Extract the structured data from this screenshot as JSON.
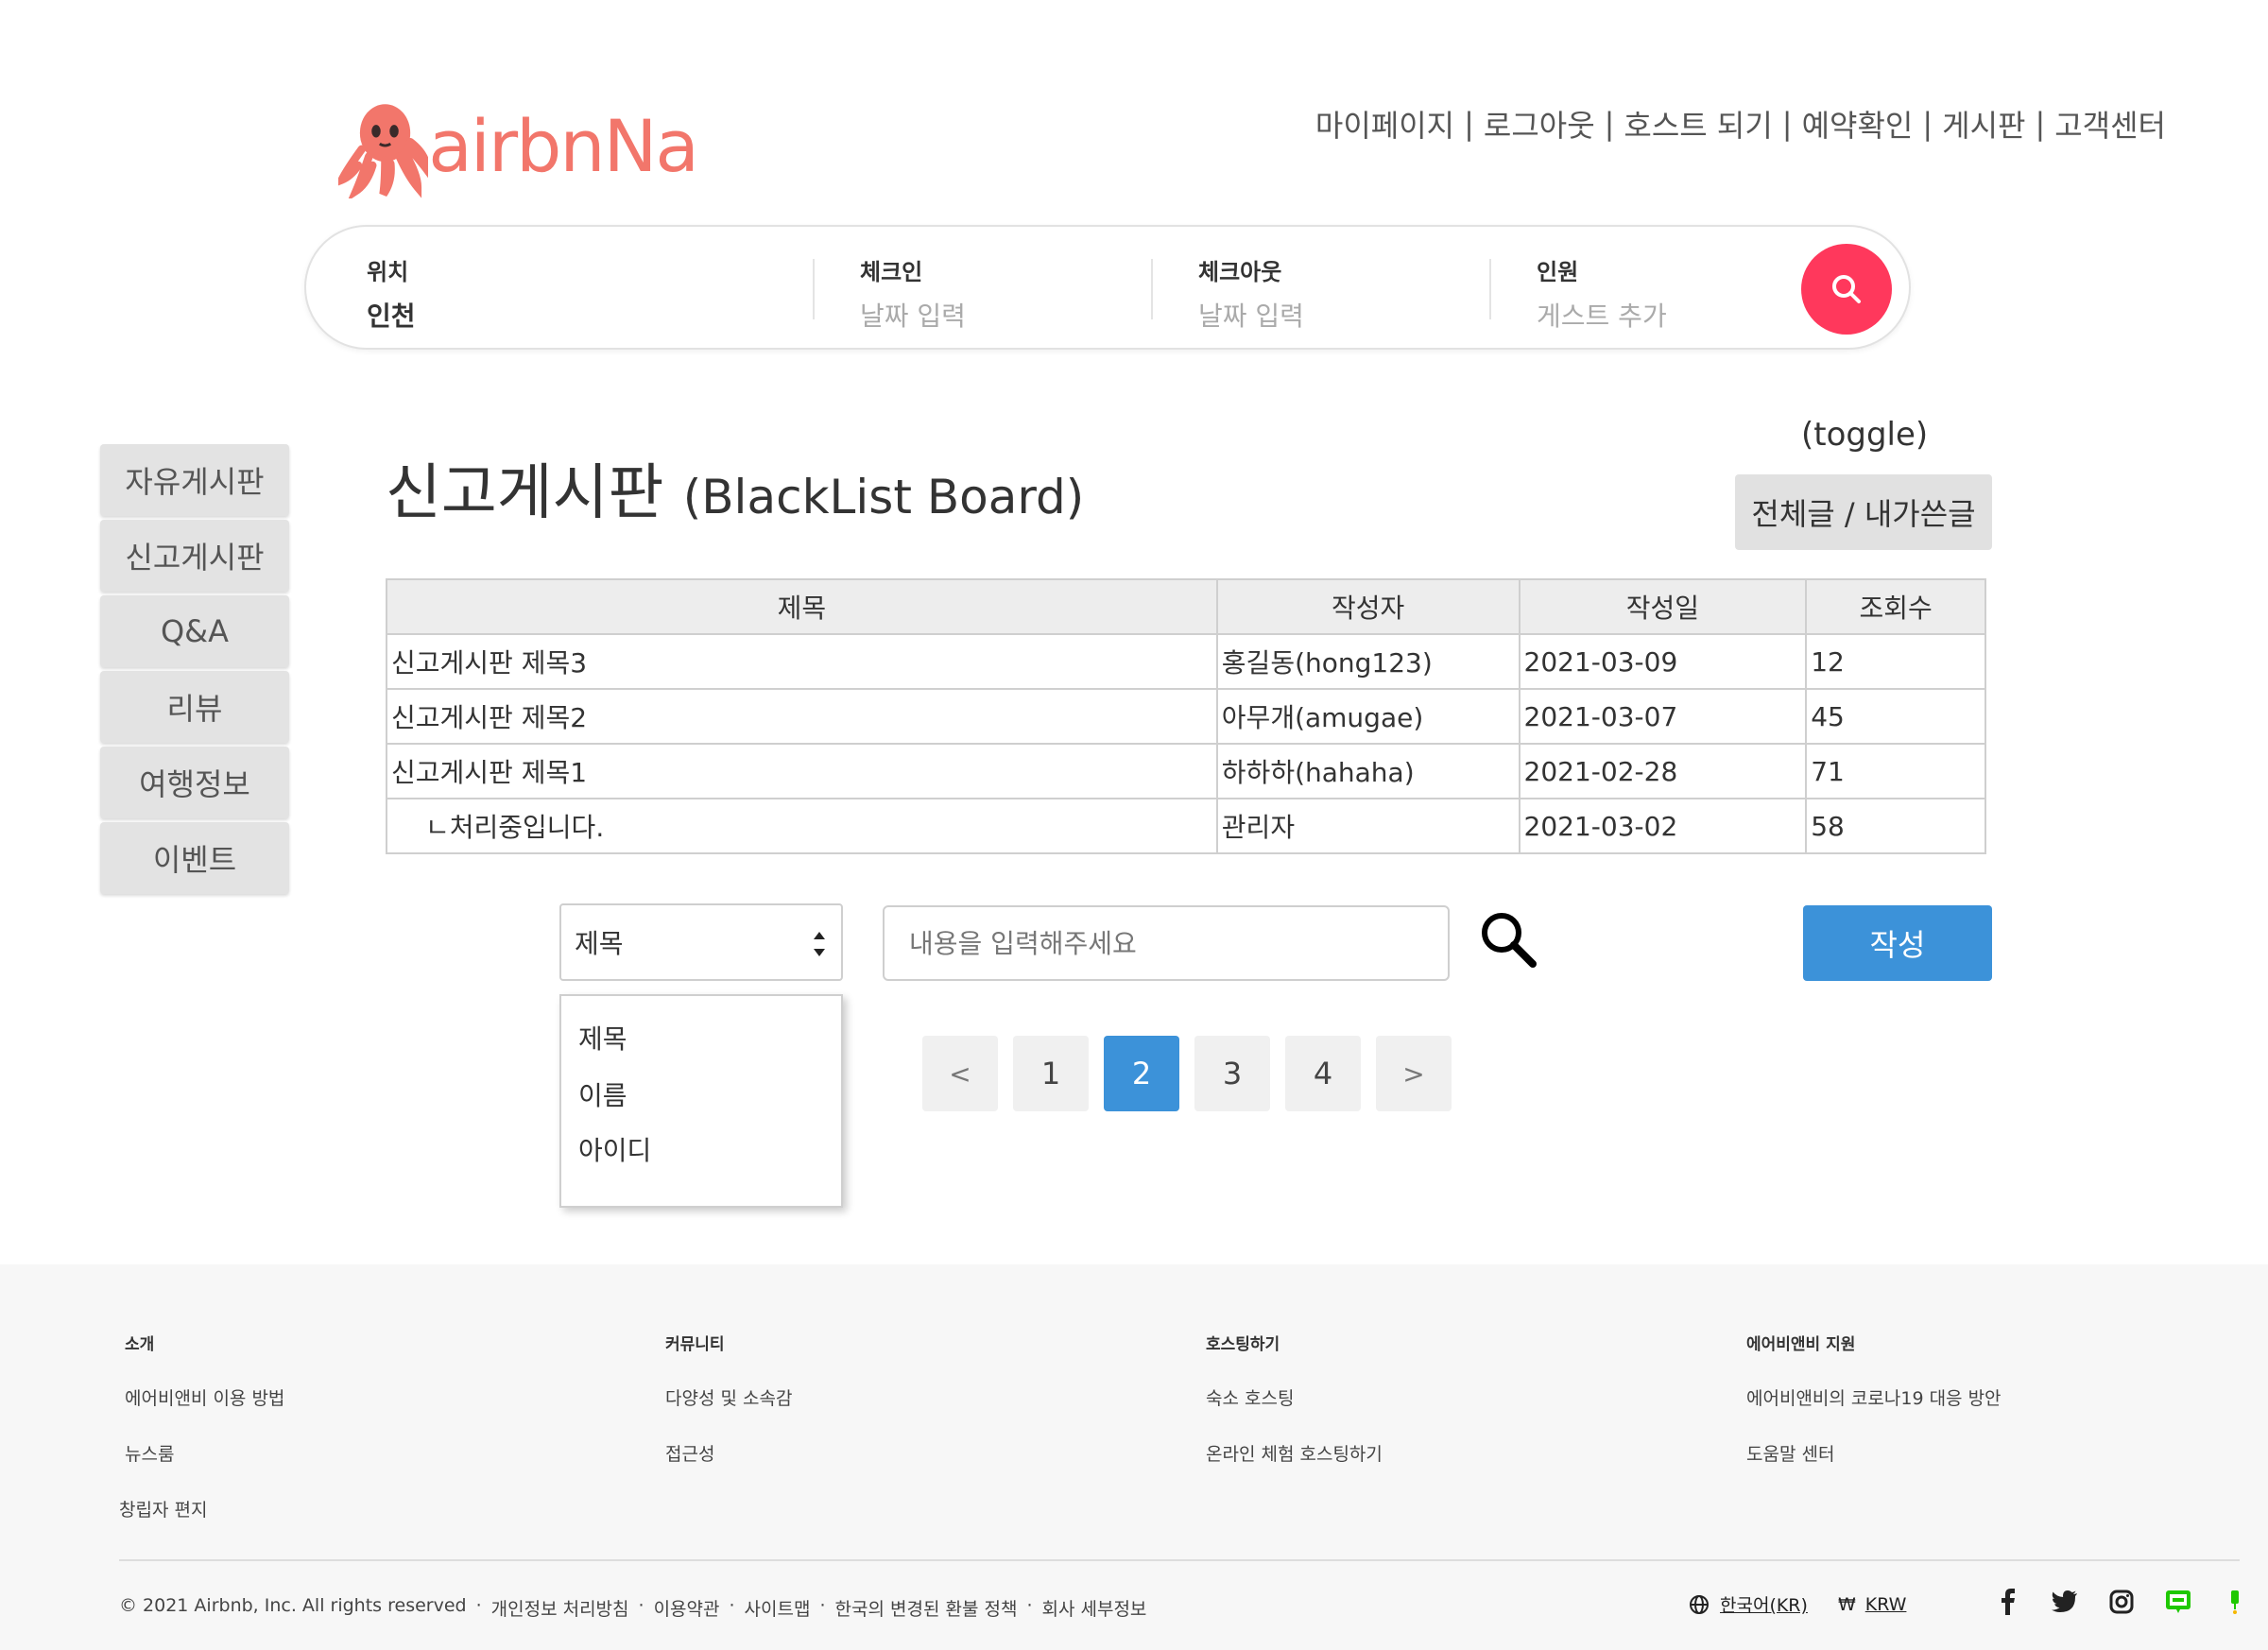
{
  "brand": {
    "name": "airbnNa",
    "color": "#f2766b"
  },
  "top_nav": [
    "마이페이지",
    "로그아웃",
    "호스트 되기",
    "예약확인",
    "게시판",
    "고객센터"
  ],
  "search_bar": {
    "location": {
      "label": "위치",
      "value": "인천"
    },
    "checkin": {
      "label": "체크인",
      "placeholder": "날짜 입력"
    },
    "checkout": {
      "label": "체크아웃",
      "placeholder": "날짜 입력"
    },
    "guests": {
      "label": "인원",
      "placeholder": "게스트 추가"
    },
    "button_color": "#ff385c"
  },
  "sidebar": {
    "items": [
      "자유게시판",
      "신고게시판",
      "Q&A",
      "리뷰",
      "여행정보",
      "이벤트"
    ]
  },
  "page": {
    "title": "신고게시판",
    "subtitle": "(BlackList Board)",
    "toggle_caption": "(toggle)",
    "toggle_label": "전체글 / 내가쓴글"
  },
  "table": {
    "headers": [
      "제목",
      "작성자",
      "작성일",
      "조회수"
    ],
    "rows": [
      {
        "title": "신고게시판 제목3",
        "author": "홍길동(hong123)",
        "date": "2021-03-09",
        "views": "12"
      },
      {
        "title": "신고게시판 제목2",
        "author": "아무개(amugae)",
        "date": "2021-03-07",
        "views": "45"
      },
      {
        "title": "신고게시판 제목1",
        "author": "하하하(hahaha)",
        "date": "2021-02-28",
        "views": "71"
      },
      {
        "title": "ㄴ처리중입니다.",
        "author": "관리자",
        "date": "2021-03-02",
        "views": "58"
      }
    ]
  },
  "search": {
    "selected": "제목",
    "options": [
      "제목",
      "이름",
      "아이디"
    ],
    "placeholder": "내용을 입력해주세요",
    "write_label": "작성",
    "accent": "#3c92d9"
  },
  "pagination": {
    "prev": "<",
    "pages": [
      "1",
      "2",
      "3",
      "4"
    ],
    "current": "2",
    "next": ">"
  },
  "footer": {
    "columns": [
      {
        "heading": "소개",
        "links": [
          "에어비앤비 이용 방법",
          "뉴스룸",
          "창립자 편지"
        ]
      },
      {
        "heading": "커뮤니티",
        "links": [
          "다양성 및 소속감",
          "접근성"
        ]
      },
      {
        "heading": "호스팅하기",
        "links": [
          "숙소 호스팅",
          "온라인 체험 호스팅하기"
        ]
      },
      {
        "heading": "에어비앤비 지원",
        "links": [
          "에어비앤비의 코로나19 대응 방안",
          "도움말 센터"
        ]
      }
    ],
    "copyright": "© 2021 Airbnb, Inc. All rights reserved",
    "legal_links": [
      "개인정보 처리방침",
      "이용약관",
      "사이트맵",
      "한국의 변경된 환불 정책",
      "회사 세부정보"
    ],
    "language": "한국어(KR)",
    "currency_symbol": "₩",
    "currency": "KRW",
    "social_icons": [
      "facebook-icon",
      "twitter-icon",
      "instagram-icon",
      "naver-blog-icon",
      "naver-post-icon"
    ]
  }
}
